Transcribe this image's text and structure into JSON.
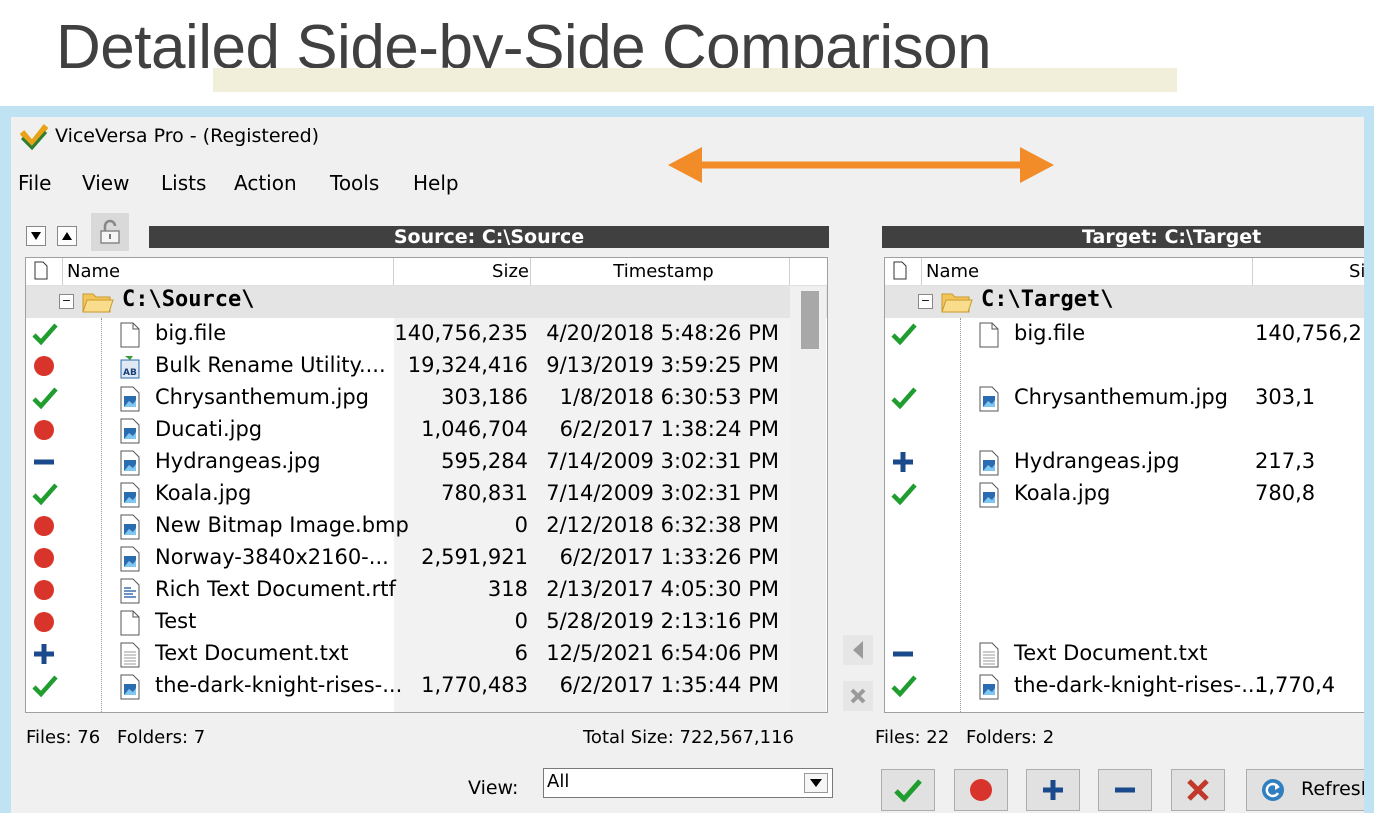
{
  "slide": {
    "title": "Detailed Side-by-Side Comparison"
  },
  "app": {
    "title": "ViceVersa Pro - (Registered)",
    "icon": "viceversa-logo-icon"
  },
  "menu": [
    "File",
    "View",
    "Lists",
    "Action",
    "Tools",
    "Help"
  ],
  "source": {
    "header": "Source: C:\\Source",
    "columns": {
      "name": "Name",
      "size": "Size",
      "timestamp": "Timestamp"
    },
    "root": "C:\\Source\\",
    "rows": [
      {
        "status": "equal",
        "icon": "file",
        "name": "big.file",
        "size": "140,756,235",
        "time": "4/20/2018 5:48:26 PM"
      },
      {
        "status": "unique",
        "icon": "app",
        "name": "Bulk Rename Utility....",
        "size": "19,324,416",
        "time": "9/13/2019 3:59:25 PM"
      },
      {
        "status": "equal",
        "icon": "image",
        "name": "Chrysanthemum.jpg",
        "size": "303,186",
        "time": "1/8/2018 6:30:53 PM"
      },
      {
        "status": "unique",
        "icon": "image",
        "name": "Ducati.jpg",
        "size": "1,046,704",
        "time": "6/2/2017 1:38:24 PM"
      },
      {
        "status": "older",
        "icon": "image",
        "name": "Hydrangeas.jpg",
        "size": "595,284",
        "time": "7/14/2009 3:02:31 PM"
      },
      {
        "status": "equal",
        "icon": "image",
        "name": "Koala.jpg",
        "size": "780,831",
        "time": "7/14/2009 3:02:31 PM"
      },
      {
        "status": "unique",
        "icon": "image",
        "name": "New Bitmap Image.bmp",
        "size": "0",
        "time": "2/12/2018 6:32:38 PM"
      },
      {
        "status": "unique",
        "icon": "image",
        "name": "Norway-3840x2160-...",
        "size": "2,591,921",
        "time": "6/2/2017 1:33:26 PM"
      },
      {
        "status": "unique",
        "icon": "rtf",
        "name": "Rich Text Document.rtf",
        "size": "318",
        "time": "2/13/2017 4:05:30 PM"
      },
      {
        "status": "unique",
        "icon": "file",
        "name": "Test",
        "size": "0",
        "time": "5/28/2019 2:13:16 PM"
      },
      {
        "status": "newer",
        "icon": "text",
        "name": "Text Document.txt",
        "size": "6",
        "time": "12/5/2021 6:54:06 PM"
      },
      {
        "status": "equal",
        "icon": "image",
        "name": "the-dark-knight-rises-...",
        "size": "1,770,483",
        "time": "6/2/2017 1:35:44 PM"
      }
    ],
    "files_label": "Files: 76",
    "folders_label": "Folders: 7",
    "total_label": "Total Size: 722,567,116"
  },
  "target": {
    "header": "Target: C:\\Target",
    "columns": {
      "name": "Name",
      "size": "Si"
    },
    "root": "C:\\Target\\",
    "rows": [
      {
        "slot": 0,
        "status": "equal",
        "icon": "file",
        "name": "big.file",
        "size": "140,756,2:"
      },
      {
        "slot": 2,
        "status": "equal",
        "icon": "image",
        "name": "Chrysanthemum.jpg",
        "size": "303,1"
      },
      {
        "slot": 4,
        "status": "newer",
        "icon": "image",
        "name": "Hydrangeas.jpg",
        "size": "217,3"
      },
      {
        "slot": 5,
        "status": "equal",
        "icon": "image",
        "name": "Koala.jpg",
        "size": "780,8"
      },
      {
        "slot": 10,
        "status": "older",
        "icon": "text",
        "name": "Text Document.txt",
        "size": ""
      },
      {
        "slot": 11,
        "status": "equal",
        "icon": "image",
        "name": "the-dark-knight-rises-...",
        "size": "1,770,4"
      }
    ],
    "files_label": "Files: 22",
    "folders_label": "Folders: 2"
  },
  "view": {
    "label": "View:",
    "selected": "All"
  },
  "actions": {
    "refresh_label": "Refresh"
  },
  "colors": {
    "check": "#1f9d2f",
    "dot": "#d9342b",
    "plus": "#1a4a8c",
    "x": "#c0392b",
    "arrow": "#f28c28"
  }
}
